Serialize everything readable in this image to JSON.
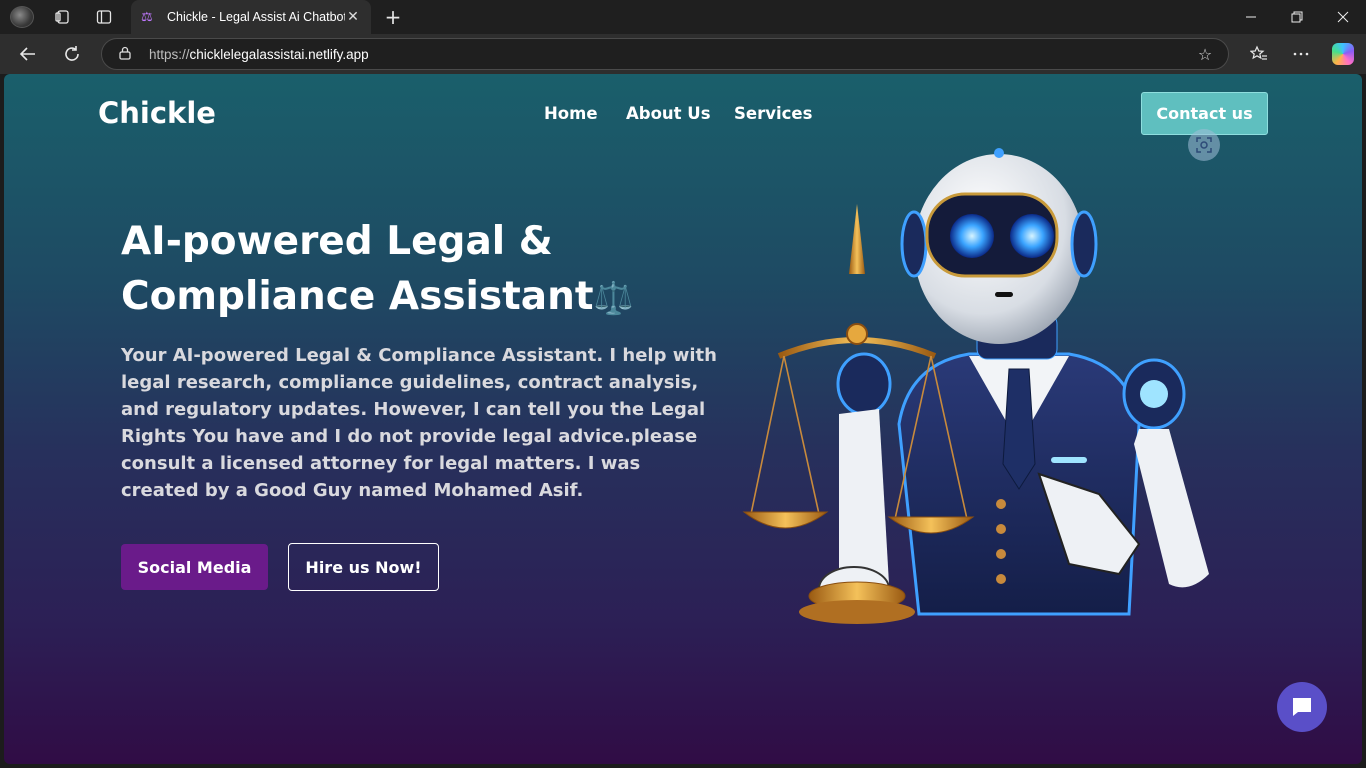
{
  "browser": {
    "tab_title": "Chickle - Legal Assist Ai Chatbot",
    "tab_close": "✕",
    "new_tab": "+",
    "url_prefix": "https://",
    "url_host": "chicklelegalassistai.netlify.app",
    "icons": [
      "profile-avatar",
      "workspaces-icon",
      "tab-actions-icon",
      "tab-favicon-scales",
      "back-icon",
      "refresh-icon",
      "lock-icon",
      "favorite-star-icon",
      "favorites-icon",
      "more-icon",
      "copilot-icon",
      "minimize-icon",
      "restore-icon",
      "close-icon"
    ]
  },
  "nav": {
    "brand": "Chickle",
    "links": [
      "Home",
      "About Us",
      "Services"
    ],
    "contact": "Contact us"
  },
  "hero": {
    "title_line1": "AI-powered Legal &",
    "title_line2": "Compliance Assistant",
    "title_emoji": "⚖️",
    "description": "Your AI-powered Legal & Compliance Assistant. I help with legal research, compliance guidelines, contract analysis, and regulatory updates. However, I can tell you the Legal Rights You have and I do not provide legal advice.please consult a licensed attorney for legal matters. I was created by a Good Guy named Mohamed Asif.",
    "btn_social": "Social Media",
    "btn_hire": "Hire us Now!"
  },
  "colors": {
    "gradient_top": "#1a5f6b",
    "gradient_bottom": "#300c45",
    "contact_btn": "#5fbfbf",
    "social_btn": "#6a1b8a",
    "chat_bubble": "#5a4fc8"
  }
}
